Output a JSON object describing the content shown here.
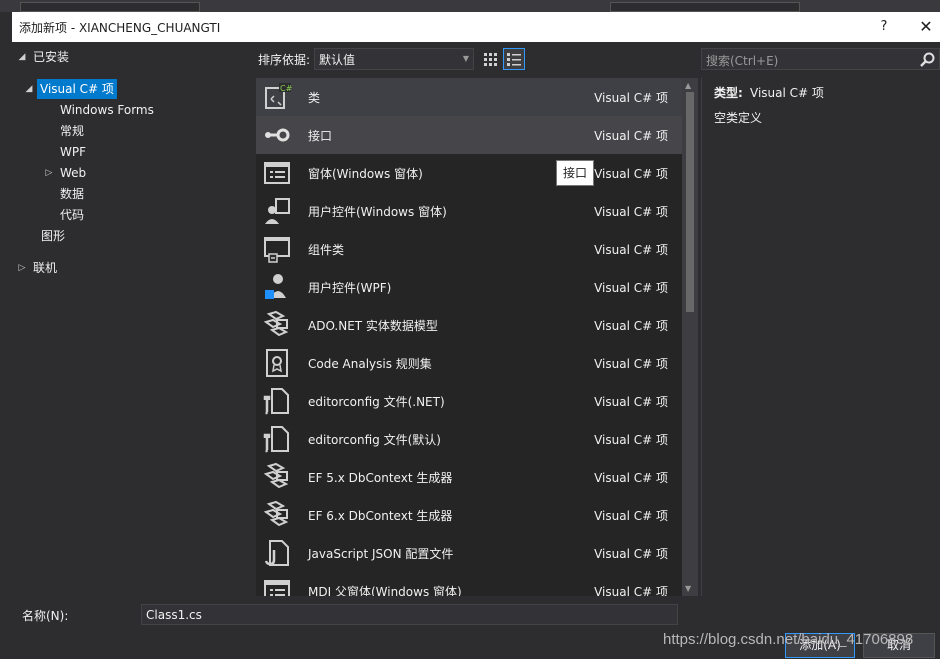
{
  "window": {
    "title": "添加新项 - XIANCHENG_CHUANGTI",
    "help": "?",
    "close": "✕"
  },
  "tree": {
    "installed": "已安装",
    "visual_csharp": "Visual C# 项",
    "windows_forms": "Windows Forms",
    "common": "常规",
    "wpf": "WPF",
    "web": "Web",
    "data": "数据",
    "code": "代码",
    "graphics": "图形",
    "online": "联机"
  },
  "toolbar": {
    "sort_label": "排序依据:",
    "sort_value": "默认值",
    "search_placeholder": "搜索(Ctrl+E)"
  },
  "items": [
    {
      "name": "类",
      "category": "Visual C# 项",
      "icon": "class-icon"
    },
    {
      "name": "接口",
      "category": "Visual C# 项",
      "icon": "interface-icon"
    },
    {
      "name": "窗体(Windows 窗体)",
      "category": "Visual C# 项",
      "icon": "form-icon"
    },
    {
      "name": "用户控件(Windows 窗体)",
      "category": "Visual C# 项",
      "icon": "user-control-icon"
    },
    {
      "name": "组件类",
      "category": "Visual C# 项",
      "icon": "component-icon"
    },
    {
      "name": "用户控件(WPF)",
      "category": "Visual C# 项",
      "icon": "wpf-user-control-icon"
    },
    {
      "name": "ADO.NET 实体数据模型",
      "category": "Visual C# 项",
      "icon": "entity-model-icon"
    },
    {
      "name": "Code Analysis 规则集",
      "category": "Visual C# 项",
      "icon": "ruleset-icon"
    },
    {
      "name": "editorconfig 文件(.NET)",
      "category": "Visual C# 项",
      "icon": "editorconfig-icon"
    },
    {
      "name": "editorconfig 文件(默认)",
      "category": "Visual C# 项",
      "icon": "editorconfig-icon"
    },
    {
      "name": "EF 5.x DbContext 生成器",
      "category": "Visual C# 项",
      "icon": "entity-model-icon"
    },
    {
      "name": "EF 6.x DbContext 生成器",
      "category": "Visual C# 项",
      "icon": "entity-model-icon"
    },
    {
      "name": "JavaScript JSON 配置文件",
      "category": "Visual C# 项",
      "icon": "json-config-icon"
    },
    {
      "name": "MDI 父窗体(Windows 窗体)",
      "category": "Visual C# 项",
      "icon": "form-icon"
    }
  ],
  "tooltip": "接口",
  "details": {
    "type_key": "类型:",
    "type_value": "Visual C# 项",
    "description": "空类定义"
  },
  "bottom": {
    "name_label": "名称(N):",
    "name_value": "Class1.cs",
    "add_button": "添加(A)",
    "cancel_button": "取消"
  },
  "watermark": "https://blog.csdn.net/baidu_41706898"
}
